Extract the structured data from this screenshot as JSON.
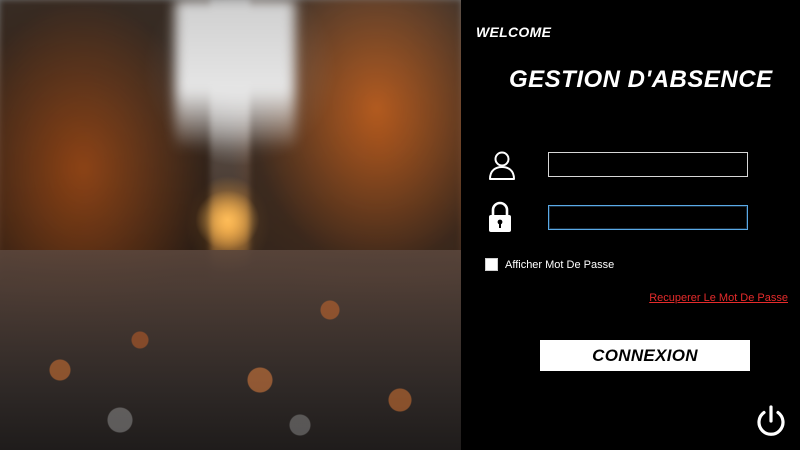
{
  "header": {
    "welcome": "WELCOME",
    "title": "GESTION D'ABSENCE"
  },
  "form": {
    "username": {
      "value": "",
      "icon": "user-icon"
    },
    "password": {
      "value": "",
      "icon": "lock-icon",
      "focused": true
    },
    "show_password": {
      "label": "Afficher Mot De Passe",
      "checked": false
    },
    "recover_link": "Recuperer Le Mot De Passe",
    "submit_label": "CONNEXION"
  },
  "controls": {
    "power_icon": "power-icon"
  },
  "colors": {
    "panel_background": "#000000",
    "text": "#ffffff",
    "link": "#e52b2b",
    "focus_border": "#5aa9e6",
    "button_background": "#ffffff"
  }
}
